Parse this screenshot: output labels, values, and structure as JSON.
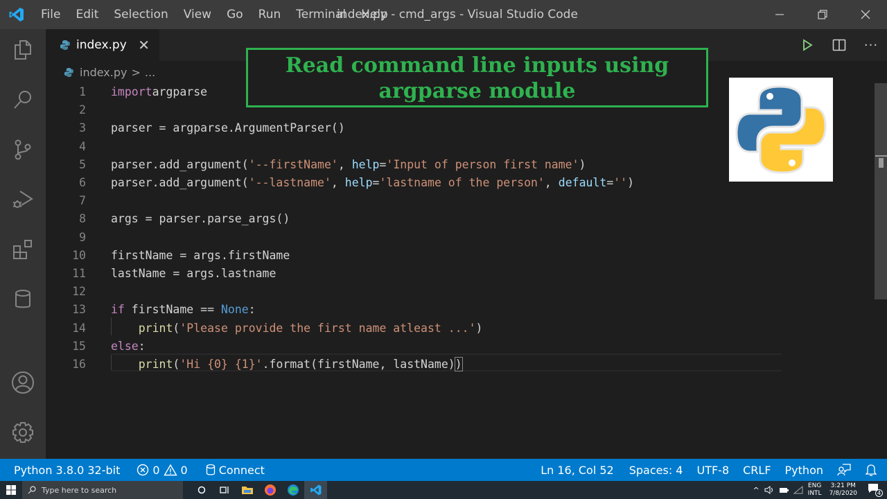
{
  "titlebar": {
    "menu": [
      "File",
      "Edit",
      "Selection",
      "View",
      "Go",
      "Run",
      "Terminal",
      "Help"
    ],
    "window_title": "index.py - cmd_args - Visual Studio Code",
    "controls": [
      "minimize",
      "restore",
      "close"
    ]
  },
  "activitybar": {
    "items": [
      "explorer",
      "search",
      "source-control",
      "run-debug",
      "extensions",
      "database"
    ],
    "bottom": [
      "accounts",
      "manage"
    ]
  },
  "tabs": [
    {
      "label": "index.py",
      "active": true
    }
  ],
  "tab_close_glyph": "✕",
  "editor_actions": [
    "run-python-file",
    "split-editor",
    "more-actions"
  ],
  "more_glyph": "···",
  "breadcrumb": {
    "file": "index.py",
    "separator": ">",
    "rest": "..."
  },
  "banner": {
    "line1": "Read command line inputs using",
    "line2": "argparse module",
    "color": "#2fb24f"
  },
  "editor": {
    "lines": [
      {
        "n": "1",
        "tokens": [
          [
            "kw",
            "import"
          ],
          [
            "",
            "argparse"
          ]
        ]
      },
      {
        "n": "2",
        "tokens": []
      },
      {
        "n": "3",
        "tokens": [
          [
            "",
            "parser = argparse.ArgumentParser()"
          ]
        ]
      },
      {
        "n": "4",
        "tokens": []
      },
      {
        "n": "5",
        "tokens": [
          [
            "",
            "parser.add_argument("
          ],
          [
            "str",
            "'--firstName'"
          ],
          [
            "",
            ", "
          ],
          [
            "param",
            "help"
          ],
          [
            "",
            "="
          ],
          [
            "str",
            "'Input of person first name'"
          ],
          [
            "",
            ")"
          ]
        ]
      },
      {
        "n": "6",
        "tokens": [
          [
            "",
            "parser.add_argument("
          ],
          [
            "str",
            "'--lastname'"
          ],
          [
            "",
            ", "
          ],
          [
            "param",
            "help"
          ],
          [
            "",
            "="
          ],
          [
            "str",
            "'lastname of the person'"
          ],
          [
            "",
            ", "
          ],
          [
            "param",
            "default"
          ],
          [
            "",
            "="
          ],
          [
            "str",
            "''"
          ],
          [
            "",
            ")"
          ]
        ]
      },
      {
        "n": "7",
        "tokens": []
      },
      {
        "n": "8",
        "tokens": [
          [
            "",
            "args = parser.parse_args()"
          ]
        ]
      },
      {
        "n": "9",
        "tokens": []
      },
      {
        "n": "10",
        "tokens": [
          [
            "",
            "firstName = args.firstName"
          ]
        ]
      },
      {
        "n": "11",
        "tokens": [
          [
            "",
            "lastName = args.lastname"
          ]
        ]
      },
      {
        "n": "12",
        "tokens": []
      },
      {
        "n": "13",
        "tokens": [
          [
            "kw",
            "if"
          ],
          [
            "",
            " firstName == "
          ],
          [
            "const",
            "None"
          ],
          [
            "",
            ":"
          ]
        ]
      },
      {
        "n": "14",
        "tokens": [
          [
            "",
            "    "
          ],
          [
            "fn",
            "print"
          ],
          [
            "",
            "("
          ],
          [
            "str",
            "'Please provide the first name atleast ...'"
          ],
          [
            "",
            ")"
          ]
        ]
      },
      {
        "n": "15",
        "tokens": [
          [
            "kw",
            "else"
          ],
          [
            "",
            ":"
          ]
        ]
      },
      {
        "n": "16",
        "tokens": [
          [
            "",
            "    "
          ],
          [
            "fn",
            "print"
          ],
          [
            "",
            "("
          ],
          [
            "str",
            "'Hi {0} {1}'"
          ],
          [
            "",
            ".format(firstName, lastName)"
          ],
          [
            "cur",
            ")"
          ]
        ]
      }
    ],
    "current_line": 16
  },
  "statusbar": {
    "interpreter": "Python 3.8.0 32-bit",
    "errors": "0",
    "warnings": "0",
    "connect": "Connect",
    "position": "Ln 16, Col 52",
    "spaces": "Spaces: 4",
    "encoding": "UTF-8",
    "eol": "CRLF",
    "language": "Python",
    "color": "#007acc"
  },
  "taskbar": {
    "search_placeholder": "Type here to search",
    "apps": [
      "cortana",
      "task-view",
      "file-explorer",
      "firefox",
      "edge",
      "vscode"
    ],
    "lang_top": "ENG",
    "lang_bottom": "INTL",
    "time": "3:21 PM",
    "date": "7/8/2020",
    "notification_count": "4"
  }
}
